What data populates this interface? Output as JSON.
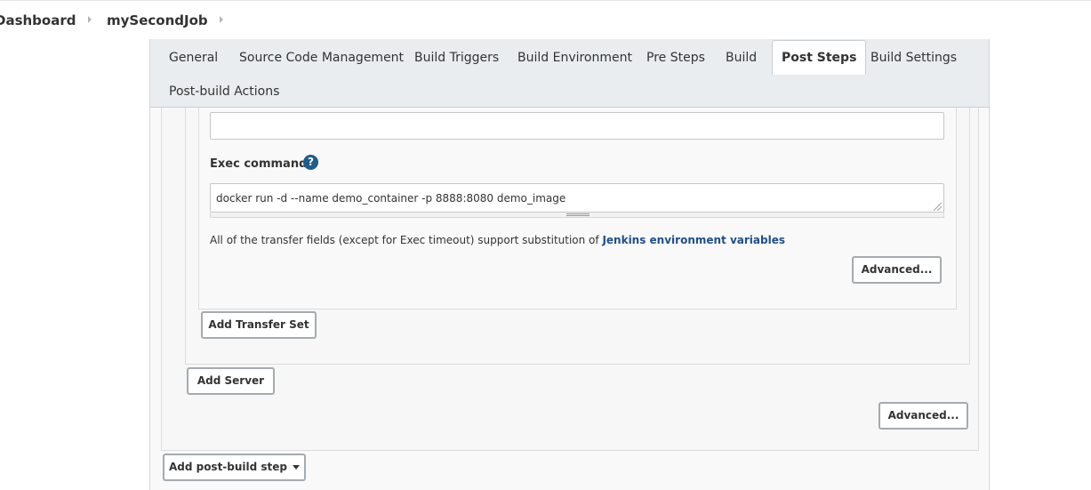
{
  "breadcrumb": {
    "items": [
      {
        "label": "Dashboard"
      },
      {
        "label": "mySecondJob"
      }
    ]
  },
  "tabs": [
    {
      "label": "General",
      "active": false
    },
    {
      "label": "Source Code Management",
      "active": false
    },
    {
      "label": "Build Triggers",
      "active": false
    },
    {
      "label": "Build Environment",
      "active": false
    },
    {
      "label": "Pre Steps",
      "active": false
    },
    {
      "label": "Build",
      "active": false
    },
    {
      "label": "Post Steps",
      "active": true
    },
    {
      "label": "Build Settings",
      "active": false
    },
    {
      "label": "Post-build Actions",
      "active": false
    }
  ],
  "transfer_set": {
    "top_field_value": "",
    "exec_command_label": "Exec command",
    "help_icon_glyph": "?",
    "exec_command_value": "docker run -d --name demo_container -p 8888:8080 demo_image",
    "info_text": "All of the transfer fields (except for Exec timeout) support substitution of ",
    "info_link": "Jenkins environment variables",
    "advanced_label": "Advanced..."
  },
  "buttons": {
    "add_transfer_set": "Add Transfer Set",
    "add_server": "Add Server",
    "advanced": "Advanced...",
    "add_post_build_step": "Add post-build step"
  },
  "colors": {
    "accent_link": "#1e4f8c",
    "help_icon": "#1d5d90",
    "tabbar_bg": "#e9edef"
  },
  "icons": {
    "breadcrumb_separator": "chevron-right-icon",
    "help": "help-icon",
    "dropdown": "caret-down-icon"
  }
}
